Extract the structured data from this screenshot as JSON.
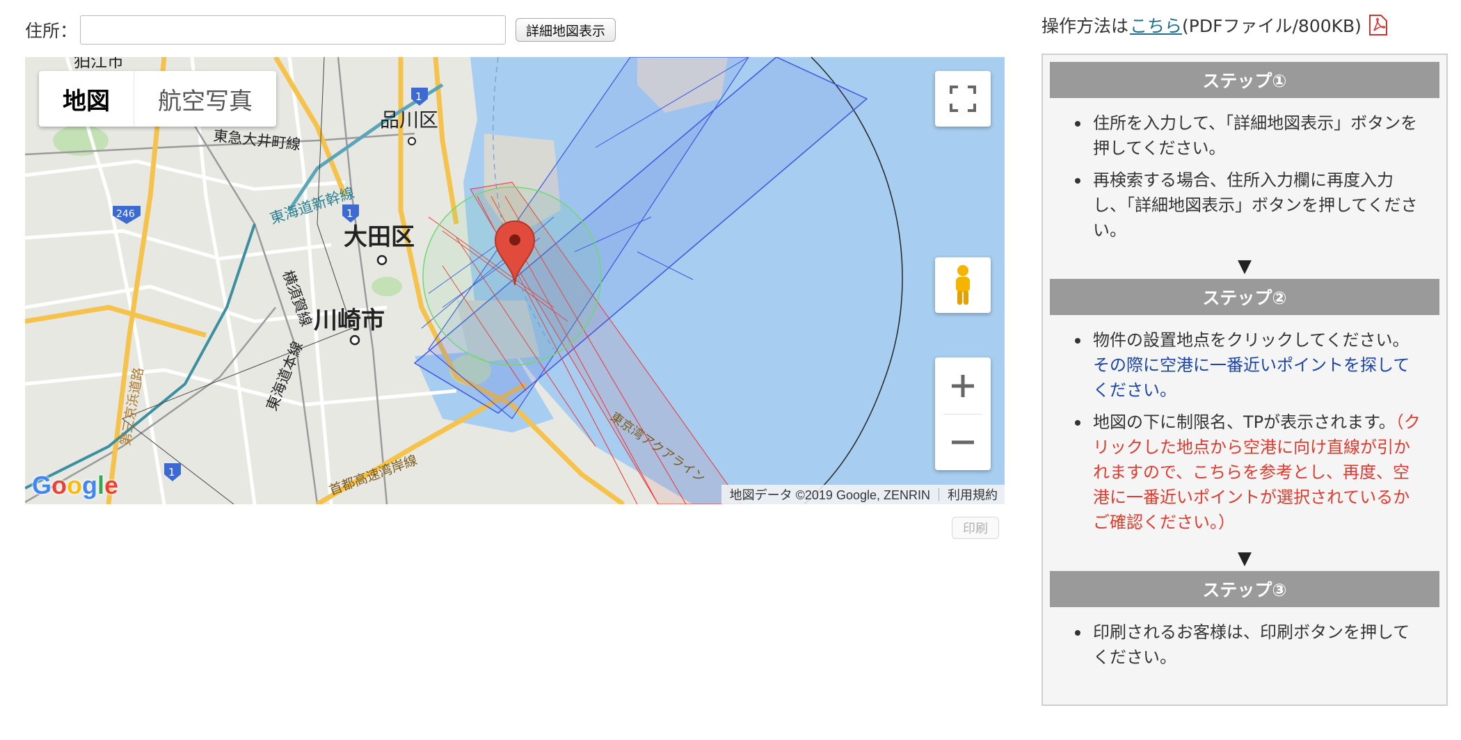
{
  "search": {
    "label": "住所：",
    "input_value": "",
    "button": "詳細地図表示"
  },
  "map": {
    "type_tabs": [
      "地図",
      "航空写真"
    ],
    "active_tab": "地図",
    "places": [
      "狛江市",
      "品川区",
      "大田区",
      "川崎市"
    ],
    "lines": [
      "東急大井町線",
      "東海道新幹線",
      "横須賀線",
      "東海道本線",
      "第三京浜道路",
      "首都高速湾岸線",
      "東京湾アクアライン"
    ],
    "shields": [
      "1",
      "1",
      "246",
      "1"
    ],
    "logo": "Google",
    "attribution": "地図データ ©2019 Google, ZENRIN",
    "terms": "利用規約",
    "icons": [
      "fullscreen-icon",
      "pegman-icon",
      "zoom-in-icon",
      "zoom-out-icon",
      "map-pin-icon"
    ]
  },
  "print_button": "印刷",
  "help": {
    "prefix": "操作方法は",
    "link": "こちら",
    "suffix": "(PDFファイル/800KB)",
    "steps": [
      {
        "title": "ステップ①",
        "items": [
          "住所を入力して、「詳細地図表示」ボタンを押してください。",
          "再検索する場合、住所入力欄に再度入力し、「詳細地図表示」ボタンを押してください。"
        ]
      },
      {
        "title": "ステップ②",
        "item1_black": "物件の設置地点をクリックしてください。",
        "item1_blue": "その際に空港に一番近いポイントを探してください。",
        "item2_black": "地図の下に制限名、TPが表示されます。",
        "item2_red": "（クリックした地点から空港に向け直線が引かれますので、こちらを参考とし、再度、空港に一番近いポイントが選択されているかご確認ください。）"
      },
      {
        "title": "ステップ③",
        "items": [
          "印刷されるお客様は、印刷ボタンを押してください。"
        ]
      }
    ],
    "arrow": "▼"
  }
}
